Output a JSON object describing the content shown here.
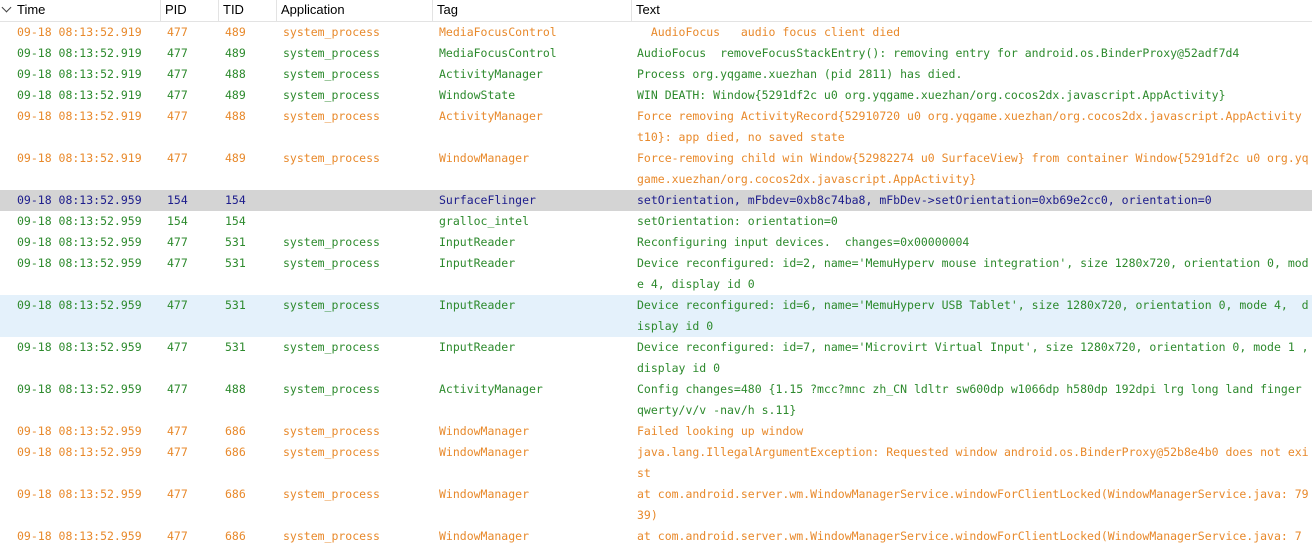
{
  "columns": {
    "time": "Time",
    "pid": "PID",
    "tid": "TID",
    "application": "Application",
    "tag": "Tag",
    "text": "Text"
  },
  "colors": {
    "warning": "#e8892b",
    "info": "#2d8a2d",
    "debug": "#1c1c8c",
    "selected_row": "#d4d4d4",
    "hover_row": "#e4f1fb"
  },
  "rows": [
    {
      "time": "09-18 08:13:52.919",
      "pid": "477",
      "tid": "489",
      "app": "system_process",
      "tag": "MediaFocusControl",
      "text": "  AudioFocus   audio focus client died",
      "level": "W",
      "lines": 1
    },
    {
      "time": "09-18 08:13:52.919",
      "pid": "477",
      "tid": "489",
      "app": "system_process",
      "tag": "MediaFocusControl",
      "text": "AudioFocus  removeFocusStackEntry(): removing entry for android.os.BinderProxy@52adf7d4",
      "level": "I",
      "lines": 1
    },
    {
      "time": "09-18 08:13:52.919",
      "pid": "477",
      "tid": "488",
      "app": "system_process",
      "tag": "ActivityManager",
      "text": "Process org.yqgame.xuezhan (pid 2811) has died.",
      "level": "I",
      "lines": 1
    },
    {
      "time": "09-18 08:13:52.919",
      "pid": "477",
      "tid": "489",
      "app": "system_process",
      "tag": "WindowState",
      "text": "WIN DEATH: Window{5291df2c u0 org.yqgame.xuezhan/org.cocos2dx.javascript.AppActivity}",
      "level": "I",
      "lines": 1
    },
    {
      "time": "09-18 08:13:52.919",
      "pid": "477",
      "tid": "488",
      "app": "system_process",
      "tag": "ActivityManager",
      "text": "Force removing ActivityRecord{52910720 u0 org.yqgame.xuezhan/org.cocos2dx.javascript.AppActivity t10}: app died, no saved state",
      "level": "W",
      "lines": 2
    },
    {
      "time": "09-18 08:13:52.919",
      "pid": "477",
      "tid": "489",
      "app": "system_process",
      "tag": "WindowManager",
      "text": "Force-removing child win Window{52982274 u0 SurfaceView} from container Window{5291df2c u0 org.yqgame.xuezhan/org.cocos2dx.javascript.AppActivity}",
      "level": "W",
      "lines": 2
    },
    {
      "time": "09-18 08:13:52.959",
      "pid": "154",
      "tid": "154",
      "app": "",
      "tag": "SurfaceFlinger",
      "text": "setOrientation, mFbdev=0xb8c74ba8, mFbDev->setOrientation=0xb69e2cc0, orientation=0",
      "level": "D",
      "lines": 1,
      "state": "selected"
    },
    {
      "time": "09-18 08:13:52.959",
      "pid": "154",
      "tid": "154",
      "app": "",
      "tag": "gralloc_intel",
      "text": "setOrientation: orientation=0",
      "level": "I",
      "lines": 1
    },
    {
      "time": "09-18 08:13:52.959",
      "pid": "477",
      "tid": "531",
      "app": "system_process",
      "tag": "InputReader",
      "text": "Reconfiguring input devices.  changes=0x00000004",
      "level": "I",
      "lines": 1
    },
    {
      "time": "09-18 08:13:52.959",
      "pid": "477",
      "tid": "531",
      "app": "system_process",
      "tag": "InputReader",
      "text": "Device reconfigured: id=2, name='MemuHyperv mouse integration', size 1280x720, orientation 0, mode 4, display id 0",
      "level": "I",
      "lines": 2
    },
    {
      "time": "09-18 08:13:52.959",
      "pid": "477",
      "tid": "531",
      "app": "system_process",
      "tag": "InputReader",
      "text": "Device reconfigured: id=6, name='MemuHyperv USB Tablet', size 1280x720, orientation 0, mode 4,  display id 0",
      "level": "I",
      "lines": 2,
      "state": "hover"
    },
    {
      "time": "09-18 08:13:52.959",
      "pid": "477",
      "tid": "531",
      "app": "system_process",
      "tag": "InputReader",
      "text": "Device reconfigured: id=7, name='Microvirt Virtual Input', size 1280x720, orientation 0, mode 1 , display id 0",
      "level": "I",
      "lines": 2
    },
    {
      "time": "09-18 08:13:52.959",
      "pid": "477",
      "tid": "488",
      "app": "system_process",
      "tag": "ActivityManager",
      "text": "Config changes=480 {1.15 ?mcc?mnc zh_CN ldltr sw600dp w1066dp h580dp 192dpi lrg long land finger qwerty/v/v -nav/h s.11}",
      "level": "I",
      "lines": 2
    },
    {
      "time": "09-18 08:13:52.959",
      "pid": "477",
      "tid": "686",
      "app": "system_process",
      "tag": "WindowManager",
      "text": "Failed looking up window",
      "level": "W",
      "lines": 1
    },
    {
      "time": "09-18 08:13:52.959",
      "pid": "477",
      "tid": "686",
      "app": "system_process",
      "tag": "WindowManager",
      "text": "java.lang.IllegalArgumentException: Requested window android.os.BinderProxy@52b8e4b0 does not exist",
      "level": "W",
      "lines": 2
    },
    {
      "time": "09-18 08:13:52.959",
      "pid": "477",
      "tid": "686",
      "app": "system_process",
      "tag": "WindowManager",
      "text": "at com.android.server.wm.WindowManagerService.windowForClientLocked(WindowManagerService.java: 7939)",
      "level": "W",
      "lines": 2
    },
    {
      "time": "09-18 08:13:52.959",
      "pid": "477",
      "tid": "686",
      "app": "system_process",
      "tag": "WindowManager",
      "text": "at com.android.server.wm.WindowManagerService.windowForClientLocked(WindowManagerService.java: 7",
      "level": "W",
      "lines": 1
    }
  ]
}
